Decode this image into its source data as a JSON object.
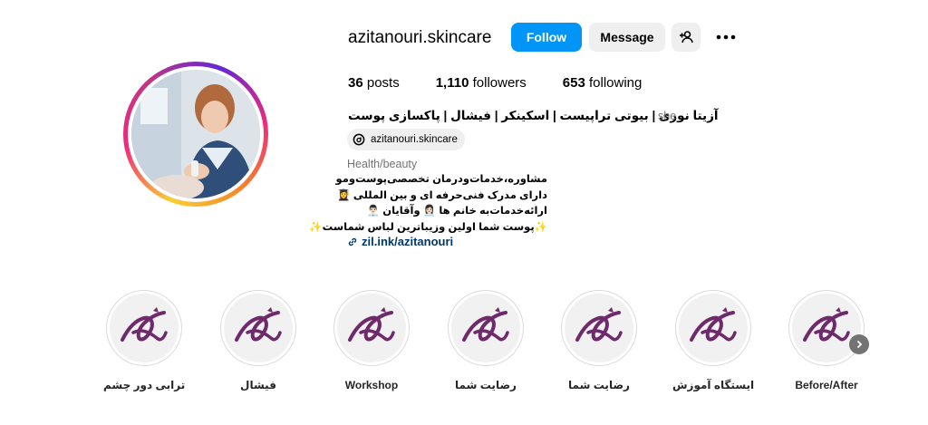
{
  "profile": {
    "username": "azitanouri.skincare",
    "follow_label": "Follow",
    "message_label": "Message",
    "stats": {
      "posts_count": "36",
      "posts_label": "posts",
      "followers_count": "1,110",
      "followers_label": "followers",
      "following_count": "653",
      "following_label": "following"
    },
    "bio_name": "آزیتا نوری | بیوتی تراپیست | اسکینکر | فیشال | پاکسازی پوست",
    "pronouns": "she",
    "threads_handle": "azitanouri.skincare",
    "category": "Health/beauty",
    "bio_lines": [
      "مشاوره،خدمات‌ودرمان تخصصی‌پوست‌ومو",
      "دارای مدرک فنی‌حرفه ای و بین المللی 👩‍🎓",
      "ارائه‌خدمات‌به خانم ها 👩🏻‍💼 وآقایان 👨🏻‍💼",
      "✨پوست شما اولین وزیباترین لباس شماست✨"
    ],
    "link": "zil.ink/azitanouri"
  },
  "highlights": [
    {
      "label": "ترابی دور چشم"
    },
    {
      "label": "فیشال"
    },
    {
      "label": "Workshop"
    },
    {
      "label": "رضایت شما"
    },
    {
      "label": "رضایت شما"
    },
    {
      "label": "ایستگاه آموزش"
    },
    {
      "label": "Before/After"
    }
  ],
  "colors": {
    "follow_button": "#0095f6",
    "secondary_button": "#efefef",
    "link": "#00376b",
    "muted_text": "#737373",
    "highlight_logo": "#6e2a6b"
  },
  "icons": {
    "add_user": "person-plus-icon",
    "more": "more-options-icon",
    "threads": "threads-icon",
    "link": "link-icon",
    "next": "chevron-right-icon"
  }
}
